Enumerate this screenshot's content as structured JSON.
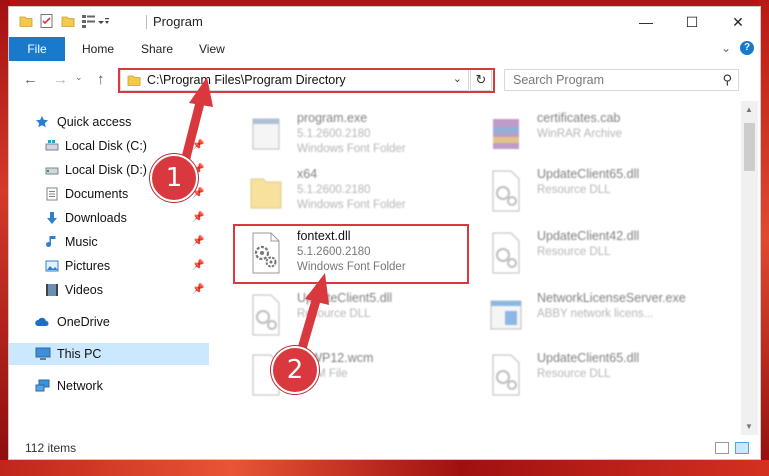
{
  "window": {
    "title": "Program",
    "minimize_glyph": "—",
    "maximize_glyph": "☐",
    "close_glyph": "✕"
  },
  "ribbon": {
    "tabs": [
      "File",
      "Home",
      "Share",
      "View"
    ],
    "collapse_glyph": "⌄",
    "help_glyph": "?"
  },
  "address": {
    "path": "C:\\Program Files\\Program Directory",
    "search_placeholder": "Search Program",
    "back_glyph": "←",
    "forward_glyph": "→",
    "up_glyph": "↑",
    "refresh_glyph": "↻",
    "dropdown_glyph": "⌄",
    "search_glyph": "⚲"
  },
  "nav": {
    "quick_access": "Quick access",
    "items": [
      {
        "label": "Local Disk (C:)",
        "icon": "drive-icon"
      },
      {
        "label": "Local Disk (D:)",
        "icon": "drive-icon"
      },
      {
        "label": "Documents",
        "icon": "documents-icon"
      },
      {
        "label": "Downloads",
        "icon": "downloads-icon"
      },
      {
        "label": "Music",
        "icon": "music-icon"
      },
      {
        "label": "Pictures",
        "icon": "pictures-icon"
      },
      {
        "label": "Videos",
        "icon": "videos-icon"
      }
    ],
    "onedrive": "OneDrive",
    "this_pc": "This PC",
    "network": "Network",
    "pin_glyph": "📌"
  },
  "files": [
    {
      "name": "program.exe",
      "line2": "5.1.2600.2180",
      "line3": "Windows Font Folder",
      "icon": "exe-icon"
    },
    {
      "name": "certificates.cab",
      "line2": "WinRAR Archive",
      "line3": "",
      "icon": "archive-icon"
    },
    {
      "name": "x64",
      "line2": "5.1.2600.2180",
      "line3": "Windows Font Folder",
      "icon": "folder-icon"
    },
    {
      "name": "UpdateClient65.dll",
      "line2": "Resource DLL",
      "line3": "",
      "icon": "dll-icon"
    },
    {
      "name": "fontext.dll",
      "line2": "5.1.2600.2180",
      "line3": "Windows Font Folder",
      "icon": "dll-icon"
    },
    {
      "name": "UpdateClient42.dll",
      "line2": "Resource DLL",
      "line3": "",
      "icon": "dll-icon"
    },
    {
      "name": "UpdateClient5.dll",
      "line2": "Resource DLL",
      "line3": "",
      "icon": "dll-icon"
    },
    {
      "name": "NetworkLicenseServer.exe",
      "line2": "ABBY network licens...",
      "line3": "",
      "icon": "app-icon"
    },
    {
      "name": "fioWP12.wcm",
      "line2": "WCM File",
      "line3": "",
      "icon": "file-icon"
    },
    {
      "name": "UpdateClient65.dll",
      "line2": "Resource DLL",
      "line3": "",
      "icon": "dll-icon"
    }
  ],
  "status": {
    "count": "112 items"
  },
  "annotations": {
    "step1": "1",
    "step2": "2",
    "color": "#d9393e"
  },
  "colors": {
    "accent": "#1979ca",
    "selected": "#cce8ff",
    "highlight": "#d9393e"
  }
}
